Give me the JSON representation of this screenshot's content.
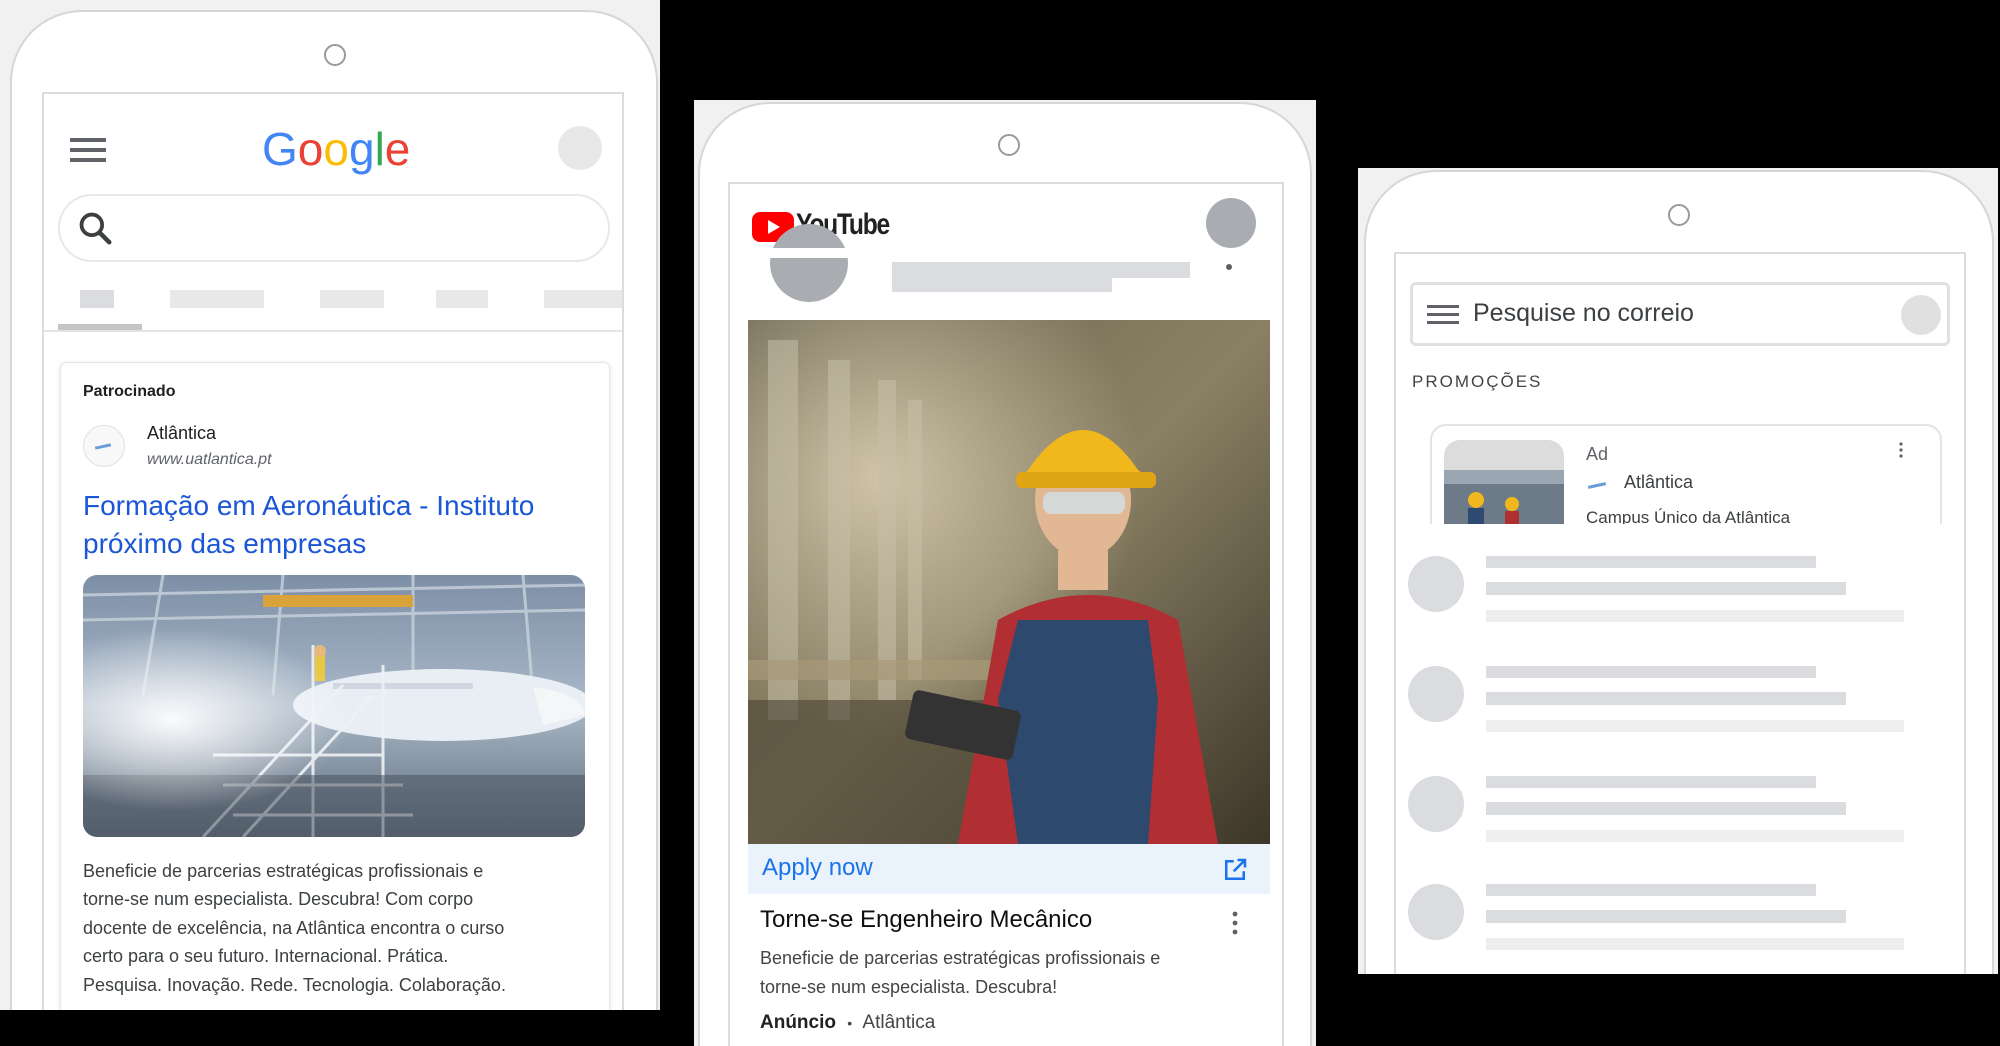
{
  "google": {
    "logo_letters": [
      {
        "ch": "G",
        "color": "#4285F4"
      },
      {
        "ch": "o",
        "color": "#EA4335"
      },
      {
        "ch": "o",
        "color": "#FBBC05"
      },
      {
        "ch": "g",
        "color": "#4285F4"
      },
      {
        "ch": "l",
        "color": "#34A853"
      },
      {
        "ch": "e",
        "color": "#EA4335"
      }
    ],
    "sponsored_label": "Patrocinado",
    "advertiser": "Atlântica",
    "url": "www.uatlantica.pt",
    "title_line1": "Formação em Aeronáutica - Instituto",
    "title_line2": "próximo das empresas",
    "desc_lines": [
      "Beneficie de parcerias estratégicas profissionais e",
      "torne-se num especialista. Descubra! Com corpo",
      "docente de excelência, na Atlântica encontra o curso",
      "certo para o seu futuro. Internacional. Prática.",
      "Pesquisa. Inovação. Rede. Tecnologia. Colaboração."
    ]
  },
  "youtube": {
    "logo_text": "YouTube",
    "cta_label": "Apply now",
    "video_title": "Torne-se Engenheiro Mecânico",
    "desc_line1": "Beneficie de parcerias estratégicas profissionais e",
    "desc_line2": "torne-se num especialista. Descubra!",
    "ad_badge": "Anúncio",
    "separator": "•",
    "advertiser": "Atlântica"
  },
  "gmail": {
    "search_placeholder": "Pesquise no correio",
    "section_label": "PROMOÇÕES",
    "ad_badge": "Ad",
    "advertiser": "Atlântica",
    "subject_partial": "Campus Único da Atlântica"
  },
  "colors": {
    "google_link": "#1a56d6",
    "youtube_red": "#ff0000",
    "youtube_link": "#1a73e8",
    "placeholder_gray": "#dadce0"
  }
}
